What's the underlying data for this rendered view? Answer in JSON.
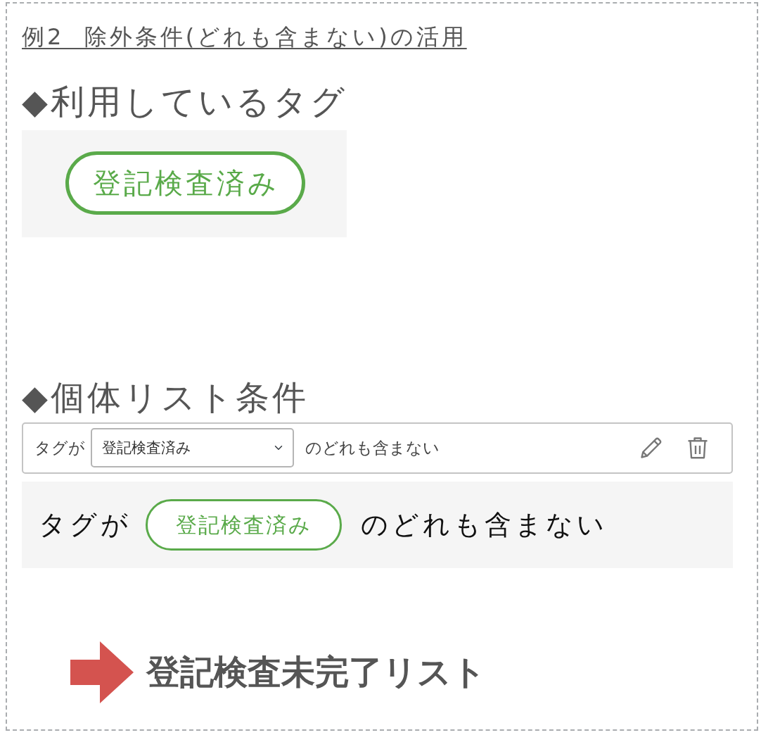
{
  "title": "例2  除外条件(どれも含まない)の活用",
  "tags_section": {
    "heading": "◆利用しているタグ",
    "tags": [
      {
        "label": "登記検査済み"
      }
    ]
  },
  "conditions_section": {
    "heading": "◆個体リスト条件",
    "condition": {
      "prefix": "タグが",
      "select": {
        "value": "登記検査済み"
      },
      "suffix": "のどれも含まない"
    },
    "preview": {
      "prefix": "タグが",
      "tag": "登記検査済み",
      "suffix": "のどれも含まない"
    }
  },
  "result": {
    "label": "登記検査未完了リスト"
  }
}
